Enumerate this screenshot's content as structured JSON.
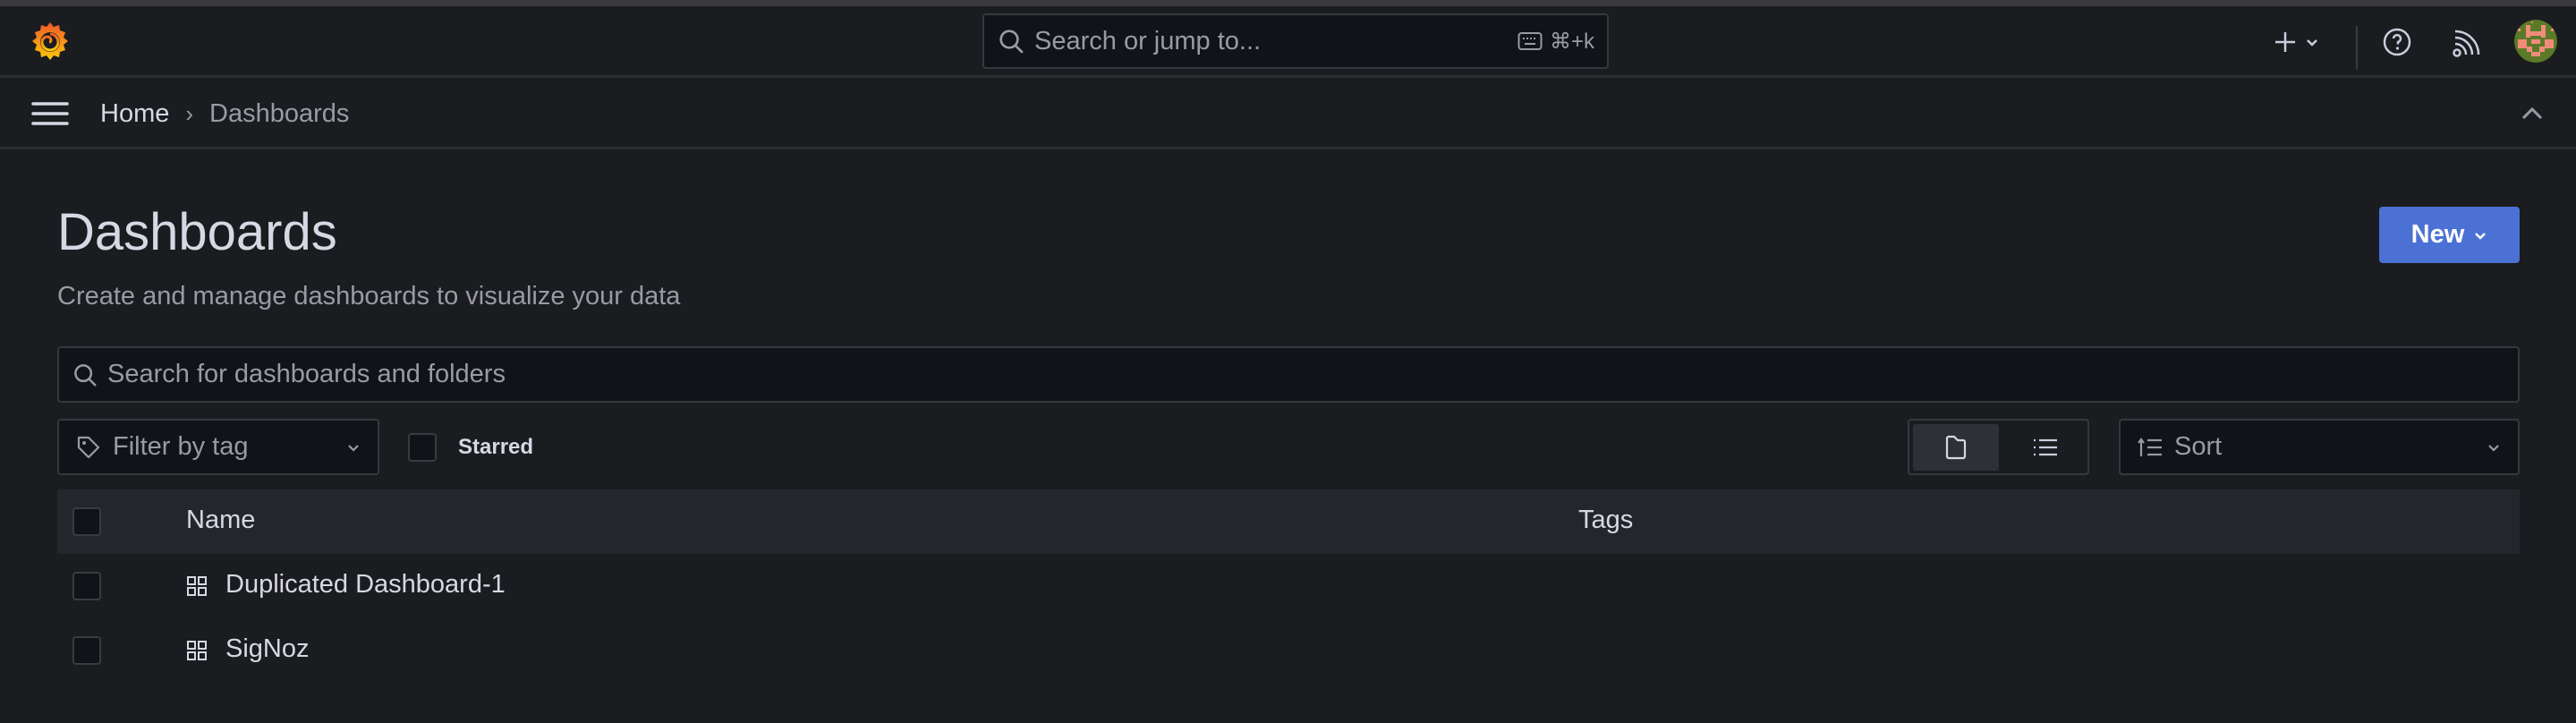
{
  "topnav": {
    "logo_icon": "grafana-logo-icon",
    "search_placeholder": "Search or jump to...",
    "search_shortcut": "⌘+k",
    "add_icon": "plus-icon",
    "help_icon": "help-circle-icon",
    "news_icon": "rss-icon",
    "avatar_colors": {
      "bg": "#5a7a28",
      "fg": "#f08c7a"
    }
  },
  "breadcrumb": {
    "items": [
      "Home",
      "Dashboards"
    ],
    "separator": "›"
  },
  "page": {
    "title": "Dashboards",
    "subtitle": "Create and manage dashboards to visualize your data",
    "new_button_label": "New"
  },
  "search": {
    "placeholder": "Search for dashboards and folders",
    "value": ""
  },
  "filters": {
    "tag_placeholder": "Filter by tag",
    "starred_label": "Starred",
    "starred_checked": false,
    "view_mode": "folders",
    "view_modes": [
      "folders",
      "list"
    ],
    "sort_placeholder": "Sort"
  },
  "table": {
    "columns": [
      "Name",
      "Tags"
    ],
    "rows": [
      {
        "name": "Duplicated Dashboard-1",
        "tags": [],
        "type": "dashboard",
        "checked": false
      },
      {
        "name": "SigNoz",
        "tags": [],
        "type": "dashboard",
        "checked": false
      }
    ]
  },
  "colors": {
    "accent": "#4c71d4",
    "background": "#1b1c20",
    "panel": "#121318",
    "header_row": "#25262c",
    "text_primary": "#d8d8e4",
    "text_secondary": "#9a9aa5"
  }
}
